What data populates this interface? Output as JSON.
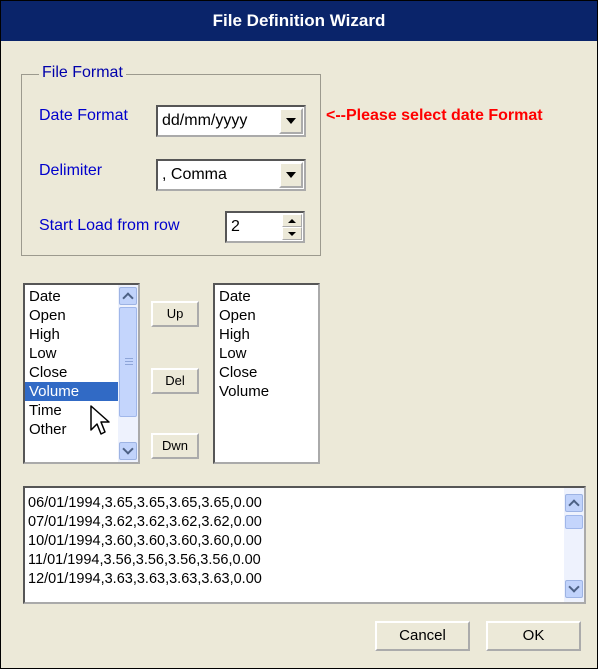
{
  "window": {
    "title": "File Definition Wizard"
  },
  "file_format": {
    "group_title": "File Format",
    "date_format": {
      "label": "Date Format",
      "value": "dd/mm/yyyy"
    },
    "delimiter": {
      "label": "Delimiter",
      "value": ", Comma"
    },
    "start_row": {
      "label": "Start Load from row",
      "value": "2"
    },
    "warning": "<--Please select date Format"
  },
  "available_fields": [
    "Date",
    "Open",
    "High",
    "Low",
    "Close",
    "Volume",
    "Time",
    "Other"
  ],
  "selected_index": 5,
  "mapping_buttons": {
    "up": "Up",
    "del": "Del",
    "down": "Dwn"
  },
  "selected_fields": [
    "Date",
    "Open",
    "High",
    "Low",
    "Close",
    "Volume"
  ],
  "data_preview": [
    "06/01/1994,3.65,3.65,3.65,3.65,0.00",
    "07/01/1994,3.62,3.62,3.62,3.62,0.00",
    "10/01/1994,3.60,3.60,3.60,3.60,0.00",
    "11/01/1994,3.56,3.56,3.56,3.56,0.00",
    "12/01/1994,3.63,3.63,3.63,3.63,0.00"
  ],
  "footer": {
    "cancel": "Cancel",
    "ok": "OK"
  }
}
